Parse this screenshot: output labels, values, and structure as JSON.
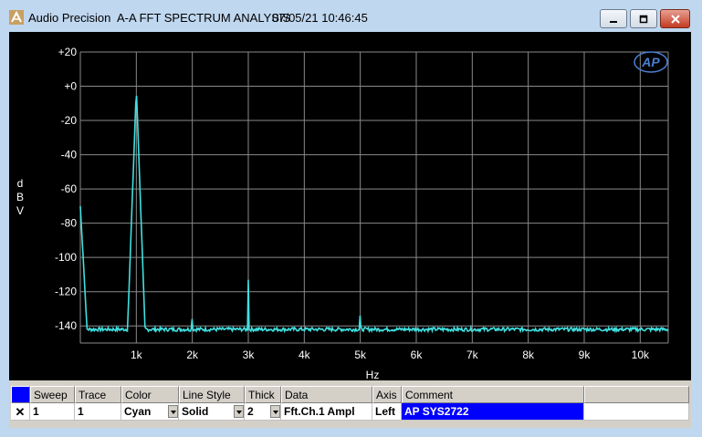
{
  "window": {
    "app_name": "Audio Precision",
    "document_title": "A-A FFT SPECTRUM ANALYSIS",
    "timestamp": "07/05/21 10:46:45"
  },
  "logo_text": "AP",
  "chart_data": {
    "type": "line",
    "xlabel": "Hz",
    "ylabel": "dBV",
    "ylabel_chars": [
      "d",
      "B",
      "V"
    ],
    "xlim": [
      0,
      10500
    ],
    "ylim": [
      -150,
      20
    ],
    "x_ticks": [
      1000,
      2000,
      3000,
      4000,
      5000,
      6000,
      7000,
      8000,
      9000,
      10000
    ],
    "x_tick_labels": [
      "1k",
      "2k",
      "3k",
      "4k",
      "5k",
      "6k",
      "7k",
      "8k",
      "9k",
      "10k"
    ],
    "y_ticks": [
      20,
      0,
      -20,
      -40,
      -60,
      -80,
      -100,
      -120,
      -140
    ],
    "y_tick_labels": [
      "+20",
      "+0",
      "-20",
      "-40",
      "-60",
      "-80",
      "-100",
      "-120",
      "-140"
    ],
    "grid": true,
    "series": [
      {
        "color": "#40e0e0",
        "noise_floor": -142,
        "peaks": [
          {
            "x": 20,
            "y": -82
          },
          {
            "x": 1000,
            "y": -1
          },
          {
            "x": 2000,
            "y": -125
          },
          {
            "x": 3000,
            "y": -113
          },
          {
            "x": 4000,
            "y": -136
          },
          {
            "x": 5000,
            "y": -123
          },
          {
            "x": 7000,
            "y": -139
          },
          {
            "x": 8200,
            "y": -137
          }
        ]
      }
    ]
  },
  "table": {
    "headers": [
      "Sweep",
      "Trace",
      "Color",
      "Line Style",
      "Thick",
      "Data",
      "Axis",
      "Comment"
    ],
    "row": {
      "checked": "✕",
      "sweep": "1",
      "trace": "1",
      "color": "Cyan",
      "line_style": "Solid",
      "thick": "2",
      "data": "Fft.Ch.1 Ampl",
      "axis": "Left",
      "comment": "AP SYS2722"
    }
  },
  "colors": {
    "trace": "#40e0e0",
    "plot_bg": "#000000",
    "grid": "#8a8a8a",
    "axis_text": "#ffffff",
    "selection": "#0000ff"
  }
}
